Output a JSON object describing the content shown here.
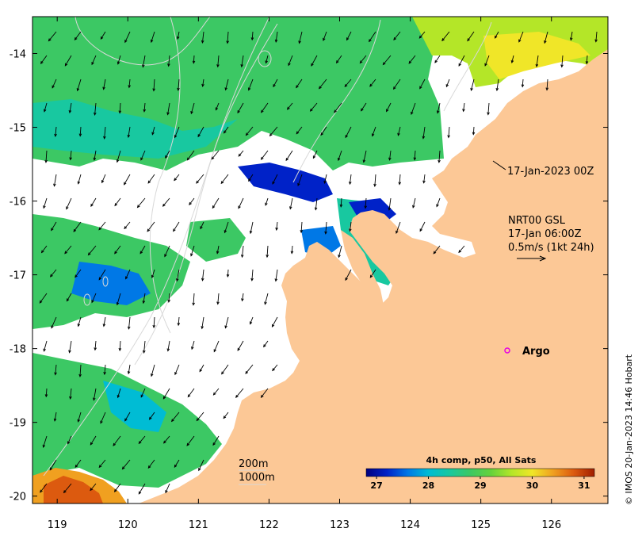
{
  "map": {
    "x_axis": {
      "ticks": [
        "119",
        "120",
        "121",
        "122",
        "123",
        "124",
        "125",
        "126"
      ],
      "range": [
        118.65,
        126.8
      ]
    },
    "y_axis": {
      "ticks": [
        "-14",
        "-15",
        "-16",
        "-17",
        "-18",
        "-19",
        "-20"
      ],
      "range": [
        -20.1,
        -13.5
      ]
    },
    "land_color": "#fcc896",
    "no_data_color": "#ffffff"
  },
  "annotations": {
    "sst_time": "17-Jan-2023 00Z",
    "current_product": "NRT00 GSL",
    "current_time": "17-Jan 06:00Z",
    "current_scale": "0.5m/s (1kt 24h)",
    "argo_label": "Argo",
    "isobath_200": "200m",
    "isobath_1000": "1000m"
  },
  "colorbar": {
    "title": "4h comp, p50, All Sats",
    "ticks": [
      "27",
      "28",
      "29",
      "30",
      "31"
    ],
    "range": [
      26.8,
      31.2
    ],
    "colors": [
      "#00007f",
      "#0022c8",
      "#0078e6",
      "#00bcd4",
      "#18c8a0",
      "#3cc864",
      "#64d23c",
      "#b4e628",
      "#f0e628",
      "#f0a020",
      "#dc5a0f",
      "#a01e00"
    ]
  },
  "credit": "© IMOS 20-Jan-2023 14:46 Hobart",
  "icons": {
    "argo": "circle-marker-icon",
    "current_arrow": "arrow-icon"
  },
  "colors": {
    "argo_marker": "#e600e6",
    "isobath": "#d8d8d8"
  }
}
